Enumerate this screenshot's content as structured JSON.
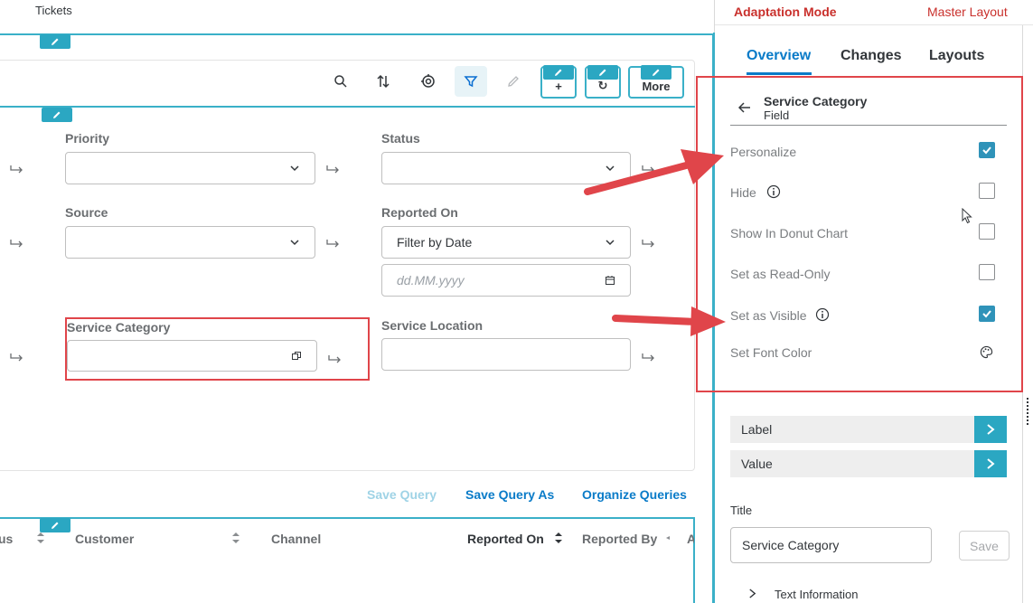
{
  "app": {
    "title": "Tickets"
  },
  "toolbar": {
    "icons": [
      "search-icon",
      "sort-icon",
      "target-icon",
      "filter-icon",
      "edit-icon"
    ],
    "more_label": "More"
  },
  "filters": {
    "priority": {
      "label": "Priority",
      "value": ""
    },
    "status": {
      "label": "Status",
      "value": ""
    },
    "source": {
      "label": "Source",
      "value": ""
    },
    "reported_on": {
      "label": "Reported On",
      "value": "Filter by Date",
      "date_placeholder": "dd.MM.yyyy"
    },
    "service_category": {
      "label": "Service Category",
      "value": ""
    },
    "service_location": {
      "label": "Service Location",
      "value": ""
    }
  },
  "queries": {
    "save": "Save Query",
    "save_as": "Save Query As",
    "organize": "Organize Queries"
  },
  "table": {
    "columns": [
      "Customer",
      "Channel",
      "Reported On",
      "Reported By"
    ],
    "partial_left": "us",
    "partial_right": "A"
  },
  "panel": {
    "mode": "Adaptation Mode",
    "layout": "Master Layout",
    "tabs": [
      "Overview",
      "Changes",
      "Layouts"
    ],
    "field": {
      "name": "Service Category",
      "type": "Field"
    },
    "properties": [
      {
        "label": "Personalize",
        "checked": true
      },
      {
        "label": "Hide",
        "checked": false
      },
      {
        "label": "Show In Donut Chart",
        "checked": false
      },
      {
        "label": "Set as Read-Only",
        "checked": false
      },
      {
        "label": "Set as Visible",
        "checked": true
      },
      {
        "label": "Set Font Color"
      }
    ],
    "sections": [
      "Label",
      "Value"
    ],
    "title_label": "Title",
    "title_value": "Service Category",
    "save_label": "Save",
    "text_info": "Text Information"
  },
  "colors": {
    "accent": "#2ba7c2",
    "link": "#0a7bc8",
    "highlight": "#e0454a"
  }
}
